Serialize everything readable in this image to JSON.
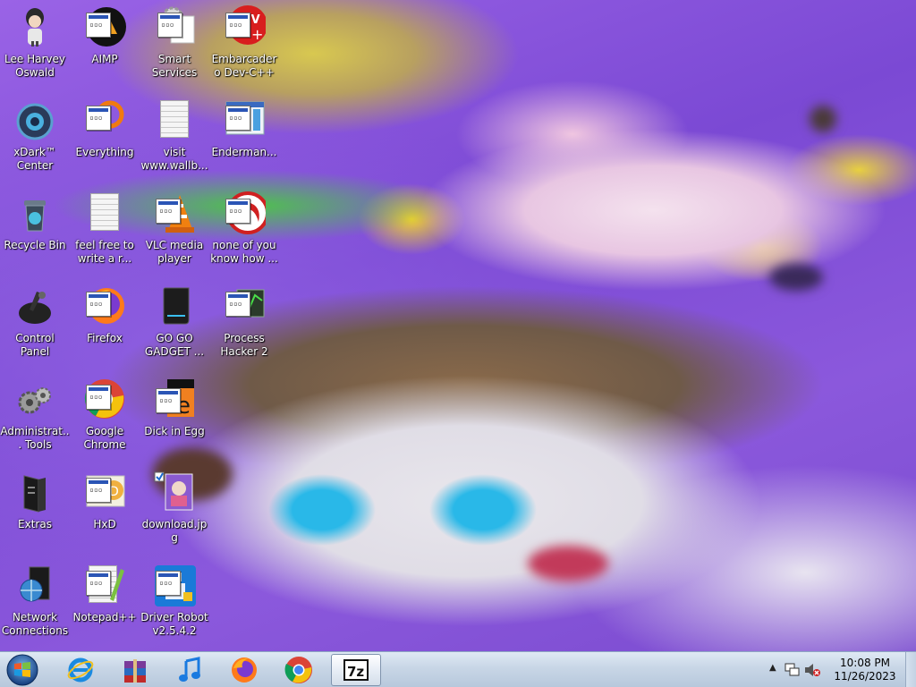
{
  "desktop": {
    "icons": [
      {
        "label": "Lee Harvey Oswald",
        "icon": "person-avatar-icon"
      },
      {
        "label": "AIMP",
        "icon": "aimp-icon"
      },
      {
        "label": "Smart Services",
        "icon": "gear-services-icon"
      },
      {
        "label": "Embarcadero Dev-C++",
        "icon": "devcpp-icon"
      },
      {
        "label": "xDark™ Center",
        "icon": "xdark-center-icon"
      },
      {
        "label": "Everything",
        "icon": "everything-search-icon"
      },
      {
        "label": "visit www.wallb...",
        "icon": "text-document-icon"
      },
      {
        "label": "Enderman...",
        "icon": "application-icon"
      },
      {
        "label": "Recycle Bin",
        "icon": "recycle-bin-icon"
      },
      {
        "label": "feel free to write a r...",
        "icon": "text-document-icon"
      },
      {
        "label": "VLC media player",
        "icon": "vlc-cone-icon"
      },
      {
        "label": "none of you know how ...",
        "icon": "red-circle-app-icon"
      },
      {
        "label": "Control Panel",
        "icon": "control-panel-icon"
      },
      {
        "label": "Firefox",
        "icon": "firefox-icon"
      },
      {
        "label": "GO GO GADGET ...",
        "icon": "gadget-device-icon"
      },
      {
        "label": "Process Hacker 2",
        "icon": "process-hacker-icon"
      },
      {
        "label": "Administrat... Tools",
        "icon": "admin-tools-gears-icon"
      },
      {
        "label": "Google Chrome",
        "icon": "chrome-icon"
      },
      {
        "label": "Dick in Egg",
        "icon": "egg-app-icon"
      },
      {
        "label": "Extras",
        "icon": "folder-dark-icon"
      },
      {
        "label": "HxD",
        "icon": "hxd-icon"
      },
      {
        "label": "download.jpg",
        "icon": "image-file-icon"
      },
      {
        "label": "Network Connections",
        "icon": "network-globe-icon"
      },
      {
        "label": "Notepad++",
        "icon": "notepadpp-icon"
      },
      {
        "label": "Driver Robot v2.5.4.2",
        "icon": "driver-robot-icon"
      }
    ]
  },
  "taskbar": {
    "pinned": [
      {
        "name": "internet-explorer",
        "icon": "internet-explorer-icon"
      },
      {
        "name": "winrar",
        "icon": "winrar-icon"
      },
      {
        "name": "itunes",
        "icon": "music-note-icon"
      },
      {
        "name": "firefox",
        "icon": "firefox-icon"
      },
      {
        "name": "chrome",
        "icon": "chrome-icon"
      },
      {
        "name": "7zip",
        "icon": "seven-zip-icon",
        "label": "7z"
      }
    ],
    "clock": {
      "time": "10:08 PM",
      "date": "11/26/2023"
    }
  },
  "colors": {
    "accent": "#2b55b5",
    "taskbar": "#c8d6e6",
    "wallpaper": "#7b49d4"
  }
}
